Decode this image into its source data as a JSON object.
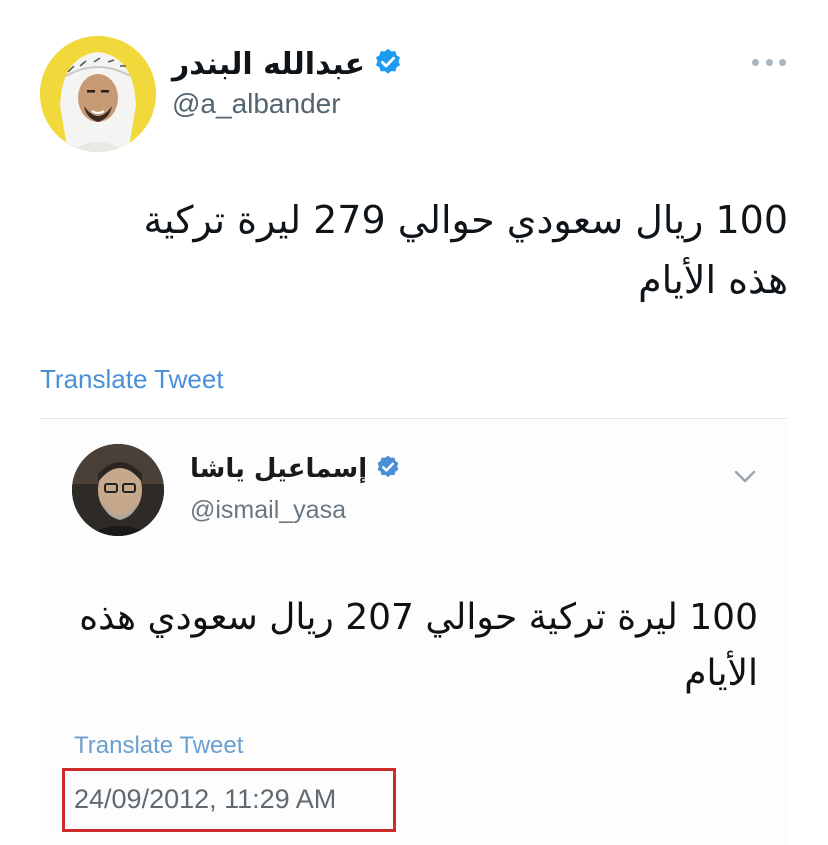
{
  "tweet": {
    "author_name": "عبدالله البندر",
    "handle": "@a_albander",
    "verified": true,
    "text_lines": [
      "100 ريال سعودي حوالي 279 ليرة تركية",
      "هذه الأيام"
    ],
    "translate_label": "Translate Tweet"
  },
  "quoted": {
    "author_name": "إسماعيل ياشا",
    "handle": "@ismail_yasa",
    "verified": true,
    "text_lines": [
      "100 ليرة تركية حوالي 207 ريال سعودي هذه",
      "الأيام"
    ],
    "translate_label": "Translate Tweet",
    "timestamp": "24/09/2012, 11:29 AM"
  },
  "icons": {
    "more": "more-horizontal-icon",
    "verified": "verified-badge-icon",
    "chevron": "chevron-down-icon"
  },
  "colors": {
    "verified_blue": "#1d9bf0",
    "link_blue": "#4a90d9",
    "highlight_red": "#cc2b2b",
    "avatar_bg": "#f2d93b"
  }
}
